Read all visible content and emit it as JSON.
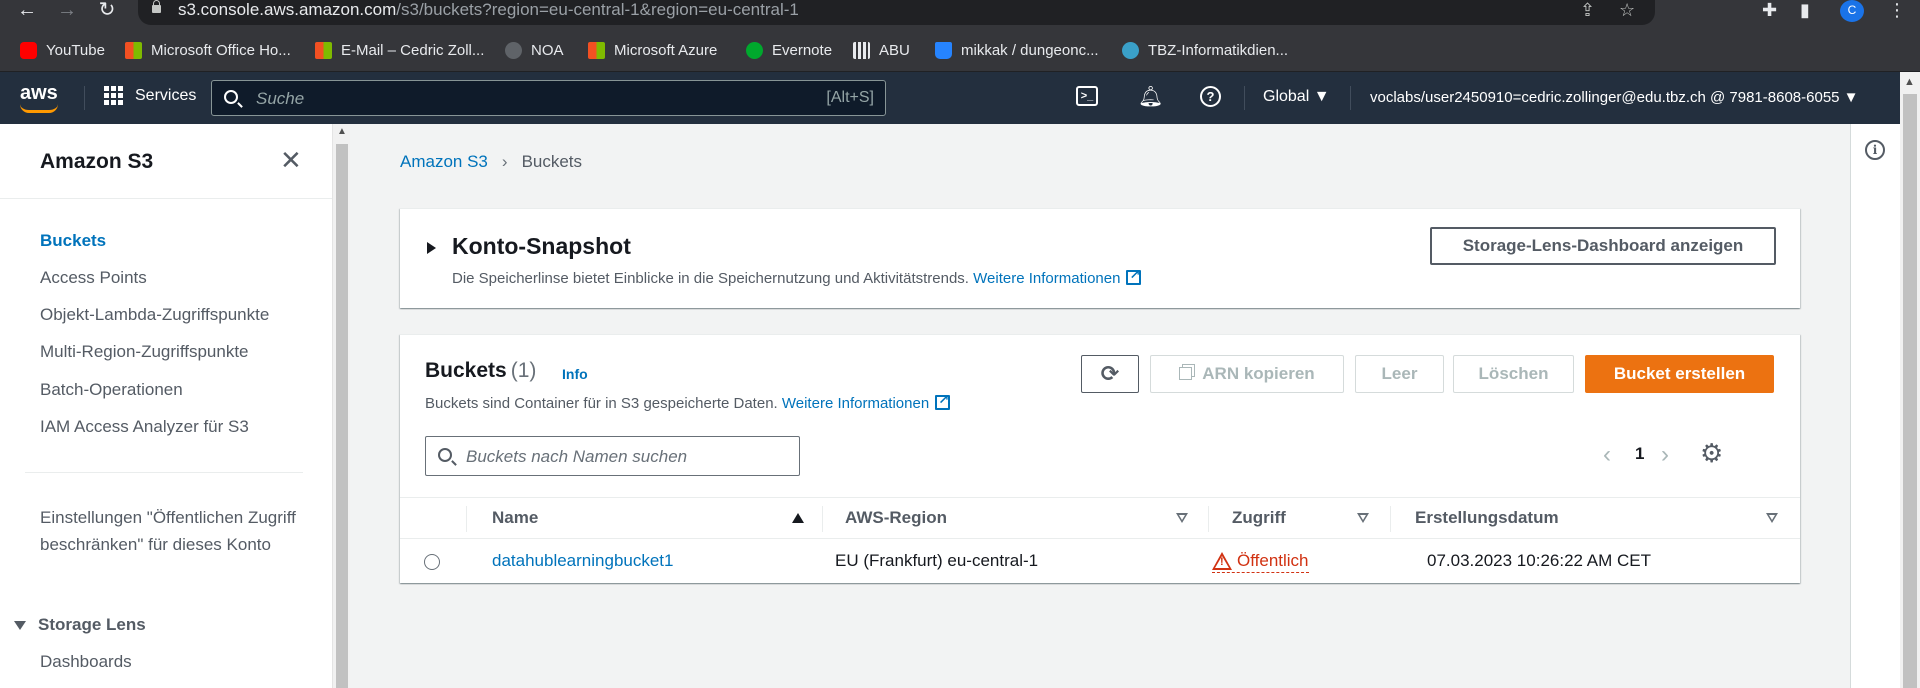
{
  "browser": {
    "url_host": "s3.console.aws.amazon.com",
    "url_path": "/s3/buckets?region=eu-central-1&region=eu-central-1",
    "profile_initial": "C",
    "bookmarks": [
      {
        "label": "YouTube",
        "color": "#ff0000"
      },
      {
        "label": "Microsoft Office Ho...",
        "color": "#f25022"
      },
      {
        "label": "E-Mail – Cedric Zoll...",
        "color": "#f25022"
      },
      {
        "label": "NOA",
        "color": "#5f6368"
      },
      {
        "label": "Microsoft Azure",
        "color": "#f25022"
      },
      {
        "label": "Evernote",
        "color": "#00a82d"
      },
      {
        "label": "ABU",
        "color": "#e8eaed"
      },
      {
        "label": "mikkak / dungeonc...",
        "color": "#2684ff"
      },
      {
        "label": "TBZ-Informatikdien...",
        "color": "#3aa0c8"
      }
    ]
  },
  "aws_nav": {
    "logo": "aws",
    "services_label": "Services",
    "search_placeholder": "Suche",
    "search_shortcut": "[Alt+S]",
    "region": "Global ▼",
    "account": "voclabs/user2450910=cedric.zollinger@edu.tbz.ch @ 7981-8608-6055 ▼",
    "accent_color": "#ff9900"
  },
  "sidenav": {
    "title": "Amazon S3",
    "items": [
      {
        "label": "Buckets",
        "active": true
      },
      {
        "label": "Access Points"
      },
      {
        "label": "Objekt-Lambda-Zugriffspunkte"
      },
      {
        "label": "Multi-Region-Zugriffspunkte"
      },
      {
        "label": "Batch-Operationen"
      },
      {
        "label": "IAM Access Analyzer für S3"
      }
    ],
    "settings_label": "Einstellungen \"Öffentlichen Zugriff beschränken\" für dieses Konto",
    "section_storage_lens": "Storage Lens",
    "dashboards": "Dashboards"
  },
  "breadcrumb": {
    "root": "Amazon S3",
    "separator": "›",
    "current": "Buckets"
  },
  "snapshot": {
    "title": "Konto-Snapshot",
    "description": "Die Speicherlinse bietet Einblicke in die Speichernutzung und Aktivitätstrends.",
    "more_info": "Weitere Informationen",
    "lens_button": "Storage-Lens-Dashboard anzeigen"
  },
  "buckets_panel": {
    "title": "Buckets",
    "count": "(1)",
    "info": "Info",
    "description": "Buckets sind Container für in S3 gespeicherte Daten.",
    "more_info": "Weitere Informationen",
    "buttons": {
      "refresh": "⟳",
      "copy_arn": "ARN kopieren",
      "empty": "Leer",
      "delete": "Löschen",
      "create": "Bucket erstellen"
    },
    "search_placeholder": "Buckets nach Namen suchen",
    "page": "1",
    "columns": [
      "Name",
      "AWS-Region",
      "Zugriff",
      "Erstellungsdatum"
    ],
    "rows": [
      {
        "name": "datahublearningbucket1",
        "region": "EU (Frankfurt) eu-central-1",
        "access": "Öffentlich",
        "created": "07.03.2023 10:26:22 AM CET"
      }
    ]
  }
}
